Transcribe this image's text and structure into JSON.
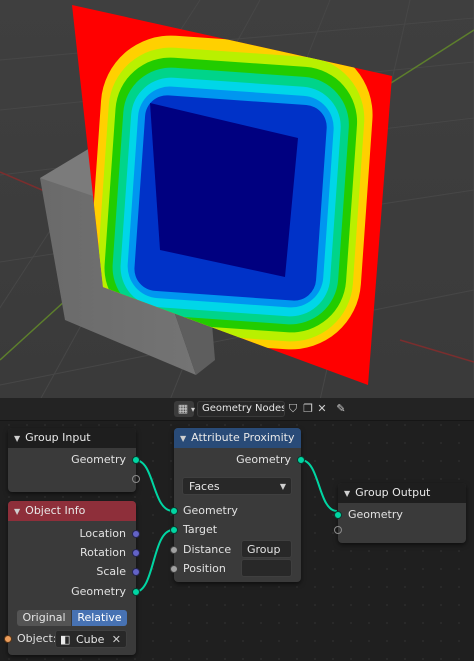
{
  "header": {
    "tree_name": "Geometry Nodes",
    "icons": [
      "editor-type-icon",
      "chevron-down-icon",
      "fake-user-shield-icon",
      "copy-icon",
      "close-icon",
      "pin-icon"
    ]
  },
  "nodes": {
    "group_input": {
      "title": "Group Input",
      "outputs": {
        "geometry": "Geometry"
      }
    },
    "attribute_proximity": {
      "title": "Attribute Proximity",
      "outputs": {
        "geometry": "Geometry"
      },
      "mode": "Faces",
      "inputs": {
        "geometry": "Geometry",
        "target": "Target",
        "distance": "Distance",
        "distance_value": "Group",
        "position": "Position",
        "position_value": ""
      }
    },
    "group_output": {
      "title": "Group Output",
      "inputs": {
        "geometry": "Geometry"
      }
    },
    "object_info": {
      "title": "Object Info",
      "outputs": {
        "location": "Location",
        "rotation": "Rotation",
        "scale": "Scale",
        "geometry": "Geometry"
      },
      "transform_space": {
        "original": "Original",
        "relative": "Relative",
        "active": "Relative"
      },
      "object_label": "Object:",
      "object_value": "Cube"
    }
  },
  "colors": {
    "geometry_socket": "#00d6a3",
    "vector_socket": "#6363c7",
    "float_socket": "#a1a1a1",
    "object_socket": "#ed9e5c",
    "group_io_header": "#1e1e1e",
    "input_node_header": "#8e2f3a",
    "attribute_node_header": "#294b78",
    "active_toggle": "#4772b3"
  }
}
